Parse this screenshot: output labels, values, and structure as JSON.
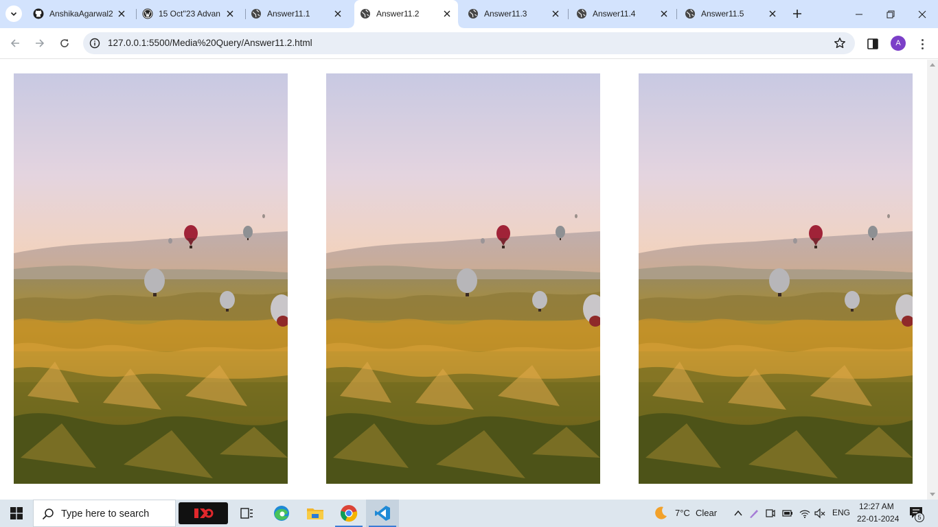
{
  "browser": {
    "tabs": [
      {
        "title": "AnshikaAgarwal2",
        "favicon": "github-icon",
        "active": false
      },
      {
        "title": "15 Oct''23 Advan",
        "favicon": "wordpress-icon",
        "active": false
      },
      {
        "title": "Answer11.1",
        "favicon": "globe-icon",
        "active": false
      },
      {
        "title": "Answer11.2",
        "favicon": "globe-icon",
        "active": true
      },
      {
        "title": "Answer11.3",
        "favicon": "globe-icon",
        "active": false
      },
      {
        "title": "Answer11.4",
        "favicon": "globe-icon",
        "active": false
      },
      {
        "title": "Answer11.5",
        "favicon": "globe-icon",
        "active": false
      }
    ],
    "url": "127.0.0.1:5500/Media%20Query/Answer11.2.html",
    "profile_initial": "A",
    "colors": {
      "tabstrip": "#d3e3fd",
      "omnibox": "#e9eef6",
      "profile": "#7b3fc8"
    }
  },
  "page": {
    "images": [
      {
        "subject": "hot-air-balloons-over-valley"
      },
      {
        "subject": "hot-air-balloons-over-valley"
      },
      {
        "subject": "hot-air-balloons-over-valley"
      }
    ]
  },
  "taskbar": {
    "search_placeholder": "Type here to search",
    "apps": [
      "task-view-icon",
      "edge-icon",
      "file-explorer-icon",
      "chrome-icon",
      "vscode-icon"
    ],
    "weather": {
      "temp": "7°C",
      "condition": "Clear"
    },
    "language": "ENG",
    "time": "12:27 AM",
    "date": "22-01-2024",
    "notification_count": "5"
  }
}
